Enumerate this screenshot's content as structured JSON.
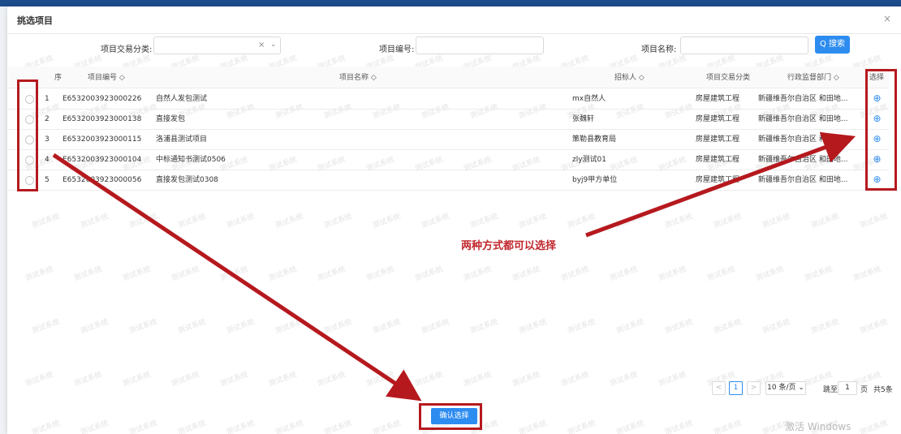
{
  "dialog": {
    "title": "挑选项目",
    "close_label": "×"
  },
  "filters": {
    "category_label": "项目交易分类:",
    "category_value": "",
    "category_clear": "×",
    "category_arrow": "⌄",
    "code_label": "项目编号:",
    "code_value": "",
    "name_label": "项目名称:",
    "name_value": "",
    "search_label": "Q 搜索"
  },
  "table": {
    "headers": {
      "seq": "序",
      "code": "项目编号 ◇",
      "name": "项目名称 ◇",
      "tenderer": "招标人 ◇",
      "category": "项目交易分类",
      "dept": "行政监督部门 ◇",
      "select": "选择"
    },
    "rows": [
      {
        "seq": "1",
        "code": "E6532003923000226",
        "name": "自然人发包测试",
        "tenderer": "mx自然人",
        "category": "房屋建筑工程",
        "dept": "新疆维吾尔自治区 和田地..."
      },
      {
        "seq": "2",
        "code": "E6532003923000138",
        "name": "直接发包",
        "tenderer": "张魏轩",
        "category": "房屋建筑工程",
        "dept": "新疆维吾尔自治区 和田地..."
      },
      {
        "seq": "3",
        "code": "E6532003923000115",
        "name": "洛浦县测试项目",
        "tenderer": "策勒县教育局",
        "category": "房屋建筑工程",
        "dept": "新疆维吾尔自治区 和田地..."
      },
      {
        "seq": "4",
        "code": "E6532003923000104",
        "name": "中标通知书测试0506",
        "tenderer": "zly测试01",
        "category": "房屋建筑工程",
        "dept": "新疆维吾尔自治区 和田地..."
      },
      {
        "seq": "5",
        "code": "E6532003923000056",
        "name": "直接发包测试0308",
        "tenderer": "byj9甲方单位",
        "category": "房屋建筑工程",
        "dept": "新疆维吾尔自治区 和田地..."
      }
    ],
    "add_icon": "⊕"
  },
  "annotation": "两种方式都可以选择",
  "pagination": {
    "prev": "<",
    "current_page": "1",
    "next": ">",
    "page_size": "10  条/页 ⌄",
    "goto_label": "跳至",
    "goto_value": "1",
    "page_label": "页",
    "total": "共5条"
  },
  "confirm_label": "确认选择",
  "watermark_text": "测试系统",
  "os_watermark": "激活 Windows",
  "colors": {
    "primary": "#2d8cf0",
    "annotation_red": "#b5191e",
    "header_bar": "#1e4d8c"
  }
}
